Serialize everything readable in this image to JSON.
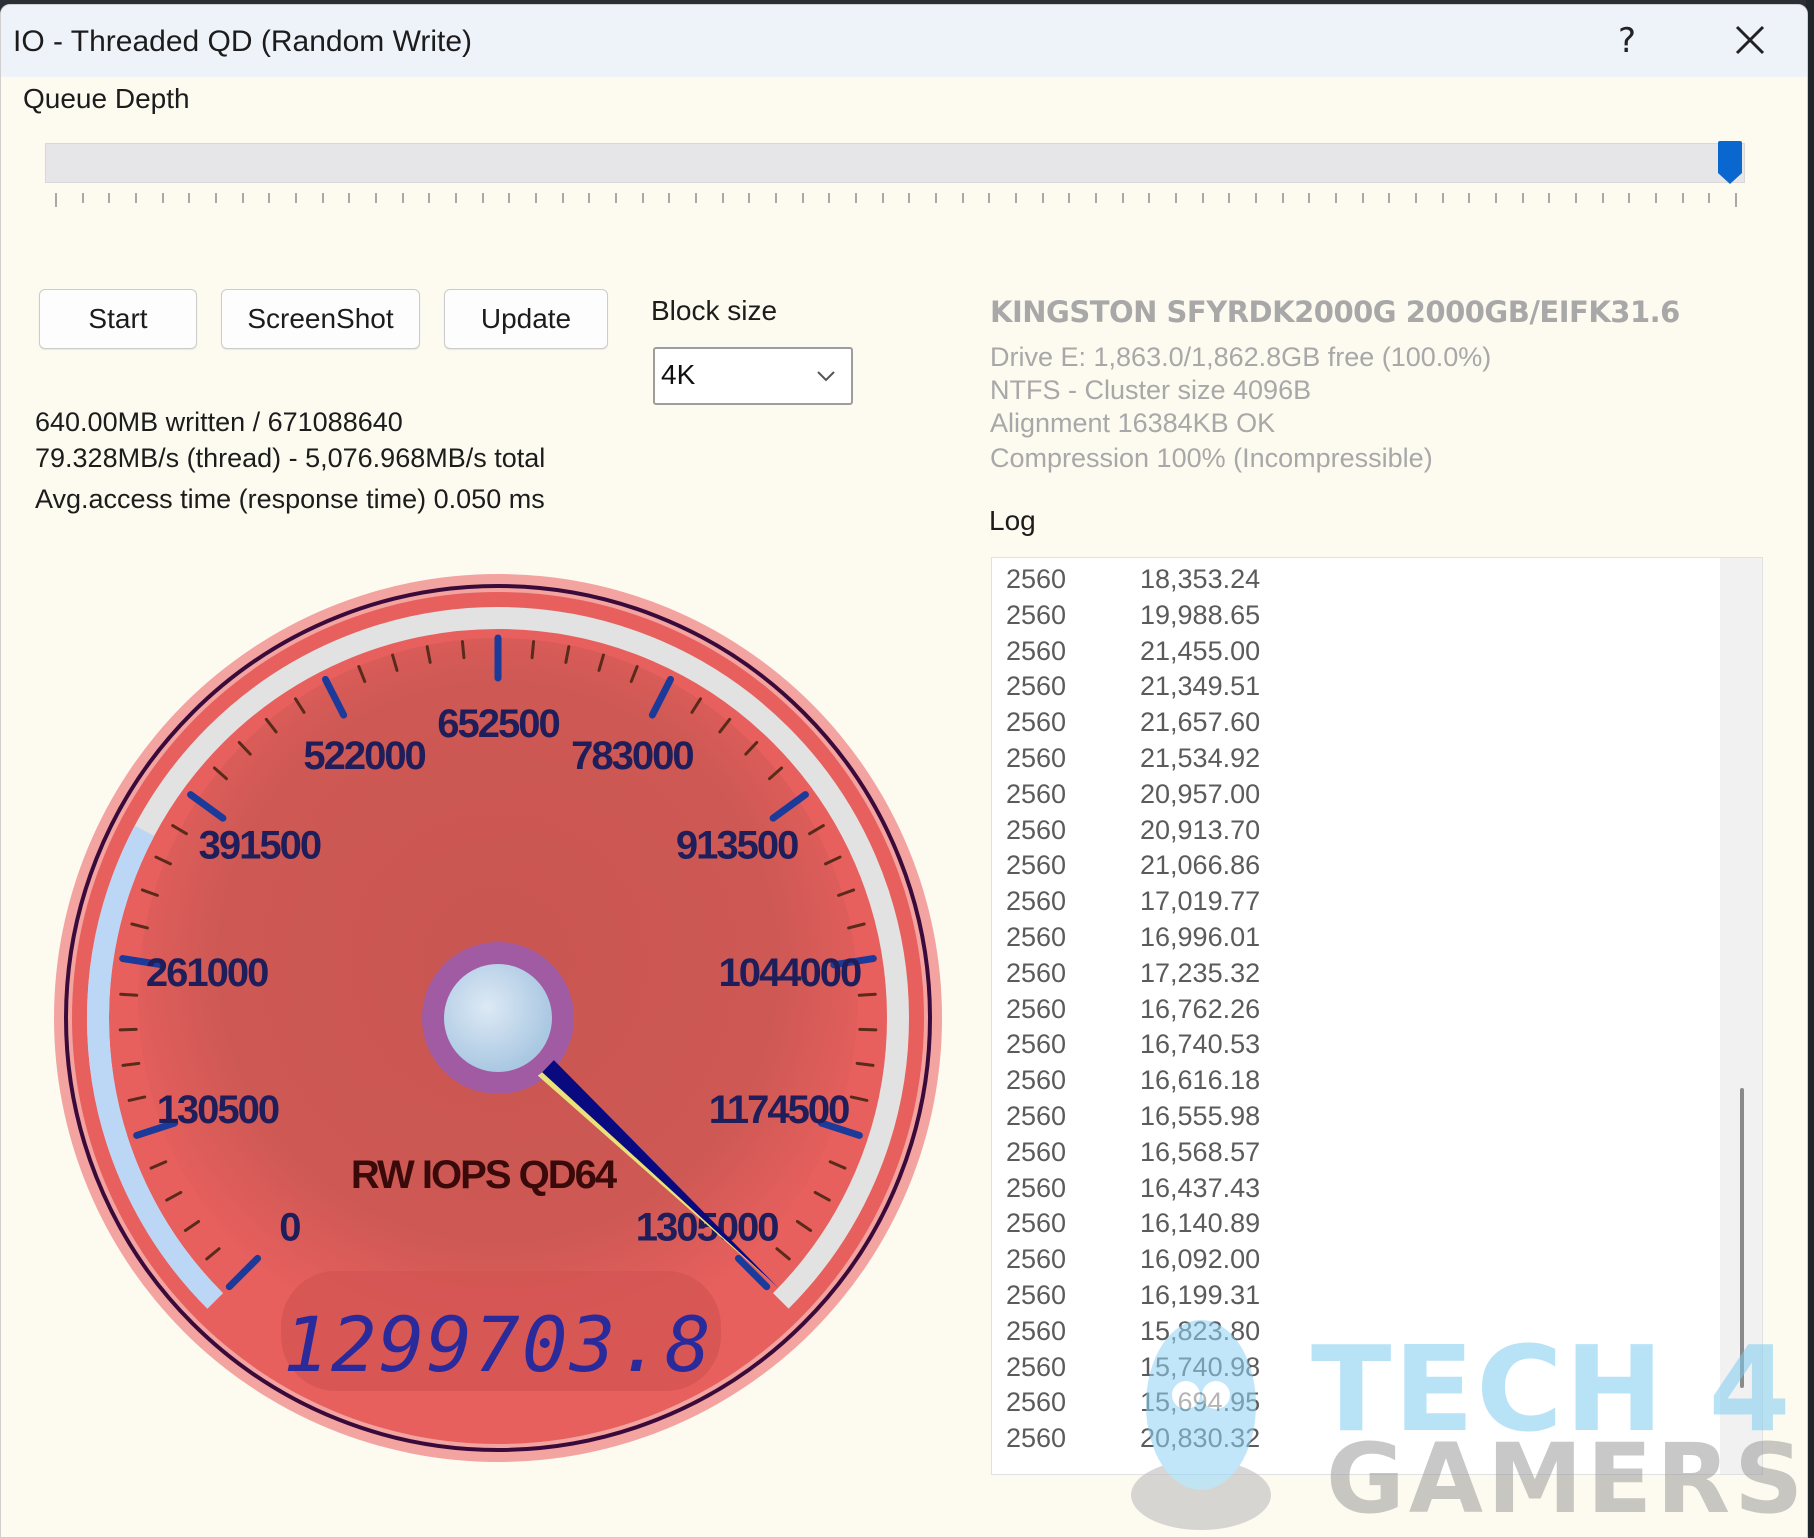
{
  "window": {
    "title": "IO - Threaded QD (Random Write)",
    "help_label": "?",
    "close_icon": "close-icon"
  },
  "queue_depth": {
    "label": "Queue Depth",
    "slider_fraction": 1.0,
    "tick_count": 64
  },
  "buttons": {
    "start": "Start",
    "screenshot": "ScreenShot",
    "update": "Update"
  },
  "block_size": {
    "label": "Block size",
    "selected": "4K"
  },
  "status": {
    "written": "640.00MB written / 671088640",
    "speed": "79.328MB/s (thread) - 5,076.968MB/s total",
    "access_time": "Avg.access time (response time) 0.050 ms"
  },
  "drive": {
    "title": "KINGSTON SFYRDK2000G 2000GB/EIFK31.6",
    "free": "Drive E: 1,863.0/1,862.8GB free (100.0%)",
    "fs": "NTFS - Cluster size 4096B",
    "alignment": "Alignment 16384KB OK",
    "compression": "Compression 100% (Incompressible)"
  },
  "log": {
    "label": "Log",
    "rows": [
      [
        "2560",
        "18,353.24"
      ],
      [
        "2560",
        "19,988.65"
      ],
      [
        "2560",
        "21,455.00"
      ],
      [
        "2560",
        "21,349.51"
      ],
      [
        "2560",
        "21,657.60"
      ],
      [
        "2560",
        "21,534.92"
      ],
      [
        "2560",
        "20,957.00"
      ],
      [
        "2560",
        "20,913.70"
      ],
      [
        "2560",
        "21,066.86"
      ],
      [
        "2560",
        "17,019.77"
      ],
      [
        "2560",
        "16,996.01"
      ],
      [
        "2560",
        "17,235.32"
      ],
      [
        "2560",
        "16,762.26"
      ],
      [
        "2560",
        "16,740.53"
      ],
      [
        "2560",
        "16,616.18"
      ],
      [
        "2560",
        "16,555.98"
      ],
      [
        "2560",
        "16,568.57"
      ],
      [
        "2560",
        "16,437.43"
      ],
      [
        "2560",
        "16,140.89"
      ],
      [
        "2560",
        "16,092.00"
      ],
      [
        "2560",
        "16,199.31"
      ],
      [
        "2560",
        "15,823.80"
      ],
      [
        "2560",
        "15,740.98"
      ],
      [
        "2560",
        "15,694.95"
      ],
      [
        "2560",
        "20,830.32"
      ]
    ]
  },
  "gauge": {
    "title": "RW IOPS QD64",
    "min": 0,
    "max": 1305000,
    "value": 1299703.8,
    "readout": "1299703.8",
    "major_labels": [
      "0",
      "130500",
      "261000",
      "391500",
      "522000",
      "652500",
      "783000",
      "913500",
      "1044000",
      "1174500",
      "1305000"
    ],
    "colors": {
      "face": "#e8605e",
      "face_inner": "#c4544f",
      "rim": "#f08e8c",
      "major_tick": "#1c3a9a",
      "minor_tick": "#5a2a1a",
      "label": "#1f1e5a",
      "needle": "#0a0a80",
      "needle_highlight": "#e8e27a",
      "hub": "#c8dff0",
      "hub_ring": "#9a5cb0",
      "arc_low": "#bcd6f5",
      "arc_track": "#e2e2e2"
    }
  },
  "watermark": {
    "line1": "TECH 4",
    "line2": "GAMERS"
  }
}
